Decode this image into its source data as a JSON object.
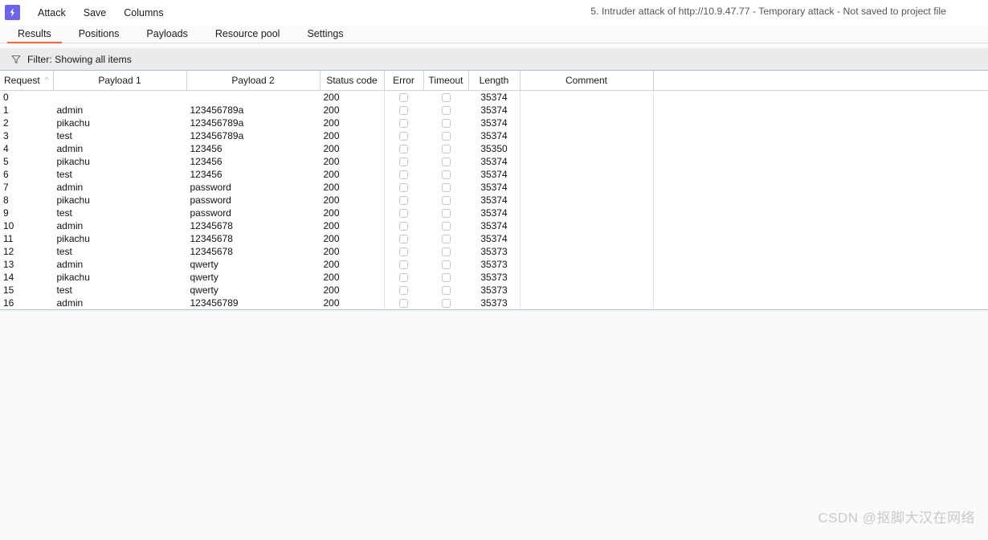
{
  "app": {
    "logo_icon": "burp-lightning-icon",
    "accent_color": "#ff6633",
    "logo_color": "#6c63ef"
  },
  "menubar": {
    "items": [
      {
        "label": "Attack"
      },
      {
        "label": "Save"
      },
      {
        "label": "Columns"
      }
    ],
    "attack_title": "5. Intruder attack of http://10.9.47.77 - Temporary attack - Not saved to project file"
  },
  "tabs": [
    {
      "label": "Results",
      "active": true
    },
    {
      "label": "Positions",
      "active": false
    },
    {
      "label": "Payloads",
      "active": false
    },
    {
      "label": "Resource pool",
      "active": false
    },
    {
      "label": "Settings",
      "active": false
    }
  ],
  "filter": {
    "icon": "funnel-icon",
    "label": "Filter: Showing all items"
  },
  "table": {
    "columns": [
      {
        "key": "request",
        "label": "Request",
        "sort": "ascending",
        "sort_glyph": "^"
      },
      {
        "key": "payload1",
        "label": "Payload 1"
      },
      {
        "key": "payload2",
        "label": "Payload 2"
      },
      {
        "key": "status",
        "label": "Status code"
      },
      {
        "key": "error",
        "label": "Error"
      },
      {
        "key": "timeout",
        "label": "Timeout"
      },
      {
        "key": "length",
        "label": "Length"
      },
      {
        "key": "comment",
        "label": "Comment"
      },
      {
        "key": "filler",
        "label": ""
      }
    ],
    "rows": [
      {
        "request": "0",
        "payload1": "",
        "payload2": "",
        "status": "200",
        "error": false,
        "timeout": false,
        "length": "35374",
        "comment": ""
      },
      {
        "request": "1",
        "payload1": "admin",
        "payload2": "123456789a",
        "status": "200",
        "error": false,
        "timeout": false,
        "length": "35374",
        "comment": ""
      },
      {
        "request": "2",
        "payload1": "pikachu",
        "payload2": "123456789a",
        "status": "200",
        "error": false,
        "timeout": false,
        "length": "35374",
        "comment": ""
      },
      {
        "request": "3",
        "payload1": "test",
        "payload2": "123456789a",
        "status": "200",
        "error": false,
        "timeout": false,
        "length": "35374",
        "comment": ""
      },
      {
        "request": "4",
        "payload1": "admin",
        "payload2": "123456",
        "status": "200",
        "error": false,
        "timeout": false,
        "length": "35350",
        "comment": ""
      },
      {
        "request": "5",
        "payload1": "pikachu",
        "payload2": "123456",
        "status": "200",
        "error": false,
        "timeout": false,
        "length": "35374",
        "comment": ""
      },
      {
        "request": "6",
        "payload1": "test",
        "payload2": "123456",
        "status": "200",
        "error": false,
        "timeout": false,
        "length": "35374",
        "comment": ""
      },
      {
        "request": "7",
        "payload1": "admin",
        "payload2": "password",
        "status": "200",
        "error": false,
        "timeout": false,
        "length": "35374",
        "comment": ""
      },
      {
        "request": "8",
        "payload1": "pikachu",
        "payload2": "password",
        "status": "200",
        "error": false,
        "timeout": false,
        "length": "35374",
        "comment": ""
      },
      {
        "request": "9",
        "payload1": "test",
        "payload2": "password",
        "status": "200",
        "error": false,
        "timeout": false,
        "length": "35374",
        "comment": ""
      },
      {
        "request": "10",
        "payload1": "admin",
        "payload2": "12345678",
        "status": "200",
        "error": false,
        "timeout": false,
        "length": "35374",
        "comment": ""
      },
      {
        "request": "11",
        "payload1": "pikachu",
        "payload2": "12345678",
        "status": "200",
        "error": false,
        "timeout": false,
        "length": "35374",
        "comment": ""
      },
      {
        "request": "12",
        "payload1": "test",
        "payload2": "12345678",
        "status": "200",
        "error": false,
        "timeout": false,
        "length": "35373",
        "comment": ""
      },
      {
        "request": "13",
        "payload1": "admin",
        "payload2": "qwerty",
        "status": "200",
        "error": false,
        "timeout": false,
        "length": "35373",
        "comment": ""
      },
      {
        "request": "14",
        "payload1": "pikachu",
        "payload2": "qwerty",
        "status": "200",
        "error": false,
        "timeout": false,
        "length": "35373",
        "comment": ""
      },
      {
        "request": "15",
        "payload1": "test",
        "payload2": "qwerty",
        "status": "200",
        "error": false,
        "timeout": false,
        "length": "35373",
        "comment": ""
      },
      {
        "request": "16",
        "payload1": "admin",
        "payload2": "123456789",
        "status": "200",
        "error": false,
        "timeout": false,
        "length": "35373",
        "comment": ""
      }
    ]
  },
  "watermark": "CSDN @抠脚大汉在网络"
}
